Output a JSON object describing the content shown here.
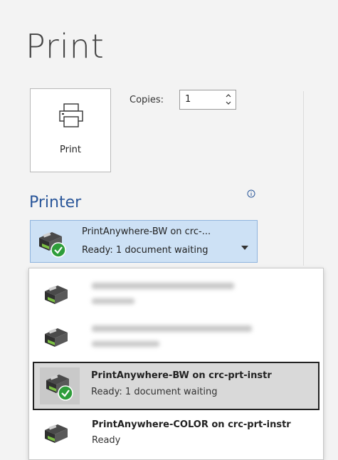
{
  "page": {
    "title": "Print"
  },
  "print_button": {
    "label": "Print"
  },
  "copies": {
    "label": "Copies:",
    "value": "1"
  },
  "printer_section": {
    "heading": "Printer",
    "selected_name": "PrintAnywhere-BW on crc-...",
    "selected_status": "Ready: 1 document waiting"
  },
  "printer_list": [
    {
      "name": "",
      "status": "",
      "blurred": true
    },
    {
      "name": "",
      "status": "",
      "blurred": true
    },
    {
      "name": "PrintAnywhere-BW on crc-prt-instr",
      "status": "Ready: 1 document waiting",
      "selected": true
    },
    {
      "name": "PrintAnywhere-COLOR on crc-prt-instr",
      "status": "Ready"
    }
  ],
  "colors": {
    "accent": "#2b579a",
    "selected_bg": "#cde1f5",
    "status_ok": "#2e9d3a"
  },
  "icons": [
    "printer-icon",
    "info-icon",
    "chevron-down-icon",
    "ready-check-icon",
    "spin-up-icon",
    "spin-down-icon"
  ]
}
